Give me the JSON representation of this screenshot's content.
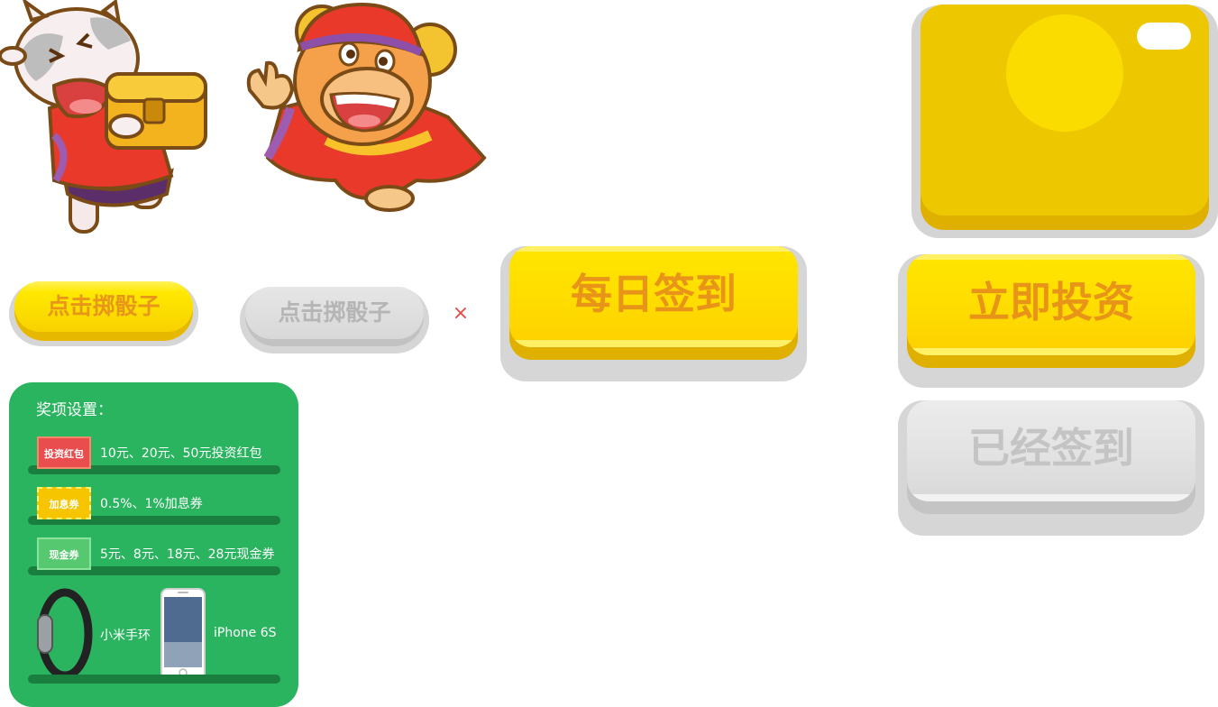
{
  "buttons": {
    "dice": "点击掷骰子",
    "dice_disabled": "点击掷骰子",
    "close": "×",
    "daily_sign": "每日签到",
    "invest_now": "立即投资",
    "already_signed": "已经签到"
  },
  "prize_panel": {
    "title": "奖项设置：",
    "rows": [
      {
        "tag": "投资红包",
        "text": "10元、20元、50元投资红包"
      },
      {
        "tag": "加息券",
        "text": "0.5%、1%加息券"
      },
      {
        "tag": "现金券",
        "text": "5元、8元、18元、28元现金券"
      }
    ],
    "gifts": [
      {
        "label": "小米手环",
        "icon": "fitness-band-icon"
      },
      {
        "label": "iPhone 6S",
        "icon": "smartphone-icon"
      }
    ]
  },
  "colors": {
    "accent_yellow": "#ffdc00",
    "button_text_orange": "#e89418",
    "disabled_gray": "#d8d8d8",
    "panel_green": "#2bb460",
    "close_red": "#e84a4a"
  }
}
